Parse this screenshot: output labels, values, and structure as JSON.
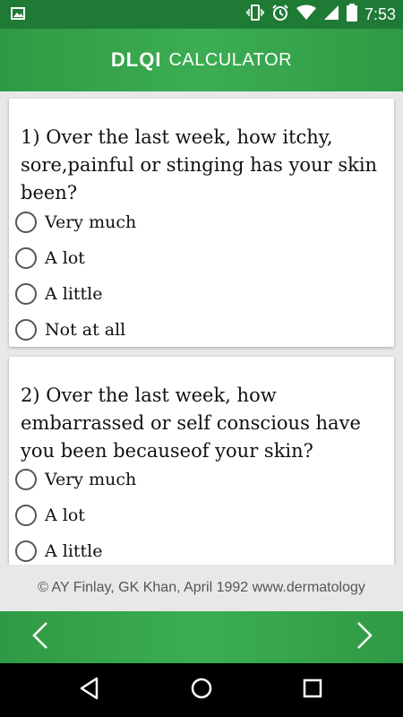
{
  "status_bar": {
    "time": "7:53",
    "icons": [
      "image-icon",
      "vibrate-icon",
      "alarm-icon",
      "wifi-icon",
      "signal-icon",
      "battery-icon"
    ]
  },
  "header": {
    "brand": "DLQI",
    "subtitle": "CALCULATOR",
    "background_color": "#34a24a"
  },
  "questions": [
    {
      "text": "1) Over the last week, how itchy, sore,painful or stinging has your skin been?",
      "options": [
        "Very much",
        "A lot",
        "A little",
        "Not at all"
      ]
    },
    {
      "text": "2) Over the last week, how embarrassed or self conscious have you been becauseof your skin?",
      "options": [
        "Very much",
        "A lot",
        "A little"
      ]
    }
  ],
  "footer": {
    "copyright": "© AY Finlay, GK Khan, April 1992 www.dermatology"
  },
  "navigation": {
    "prev_icon": "chevron-left-icon",
    "next_icon": "chevron-right-icon"
  },
  "system_nav": {
    "icons": [
      "back-icon",
      "home-icon",
      "recents-icon"
    ]
  }
}
